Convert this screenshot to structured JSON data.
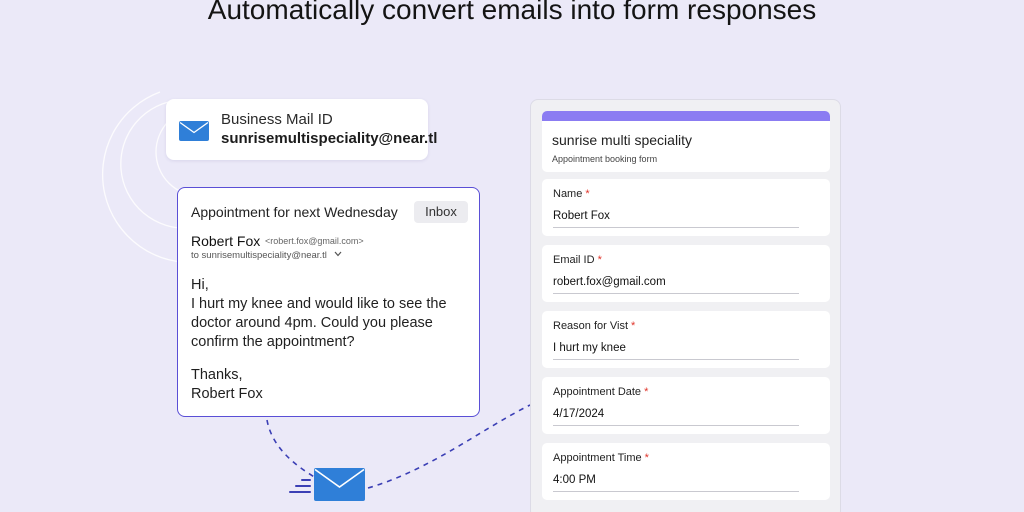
{
  "headline": "Automatically convert emails into form responses",
  "colors": {
    "background": "#ebe9f8",
    "accent": "#5a4fd6",
    "form_accent": "#8b7cf2",
    "envelope": "#2f7fd8",
    "required": "#e0342a"
  },
  "mail_id_card": {
    "icon": "envelope-icon",
    "label": "Business Mail ID",
    "address": "sunrisemultispeciality@near.tl"
  },
  "email": {
    "subject": "Appointment for next Wednesday",
    "folder_badge": "Inbox",
    "sender_name": "Robert Fox",
    "sender_address": "<robert.fox@gmail.com>",
    "recipient": "to sunrisemultispeciality@near.tl",
    "body_lines": [
      "Hi,",
      "I hurt my knee and would like to see the",
      "doctor around 4pm. Could you please",
      "confirm the appointment?"
    ],
    "signoff_lines": [
      "Thanks,",
      "Robert Fox"
    ]
  },
  "form": {
    "title": "sunrise multi speciality",
    "subtitle": "Appointment booking form",
    "required_marker": "*",
    "fields": [
      {
        "label": "Name",
        "value": "Robert Fox"
      },
      {
        "label": "Email ID",
        "value": "robert.fox@gmail.com"
      },
      {
        "label": "Reason for Vist",
        "value": "I hurt my knee"
      },
      {
        "label": "Appointment Date",
        "value": "4/17/2024"
      },
      {
        "label": "Appointment Time",
        "value": "4:00 PM"
      }
    ]
  }
}
